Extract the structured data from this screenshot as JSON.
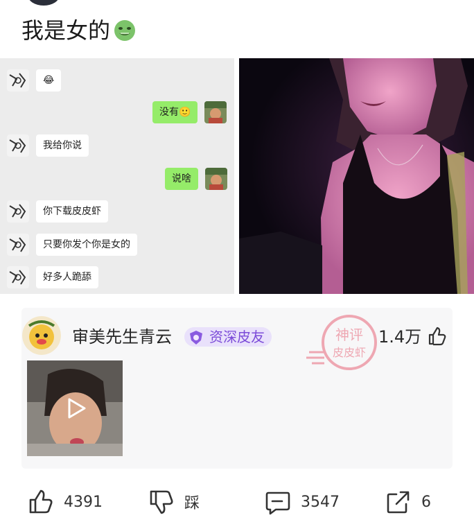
{
  "post": {
    "title": "我是女的"
  },
  "chat": {
    "messages": [
      {
        "side": "left",
        "text": "😂"
      },
      {
        "side": "right",
        "text": "没有🙂"
      },
      {
        "side": "left",
        "text": "我给你说"
      },
      {
        "side": "right",
        "text": "说啥"
      },
      {
        "side": "left",
        "text": "你下载皮皮虾"
      },
      {
        "side": "left",
        "text": "只要你发个你是女的"
      },
      {
        "side": "left",
        "text": "好多人跪舔"
      }
    ]
  },
  "comment": {
    "username": "审美先生青云",
    "badge": "资深皮友",
    "like_count": "1.4万",
    "stamp_text_1": "神评",
    "stamp_text_2": "皮皮虾"
  },
  "actions": {
    "like_count": "4391",
    "dislike_label": "踩",
    "comment_count": "3547",
    "share_count": "6"
  },
  "colors": {
    "wechat_green": "#95ec69",
    "badge_purple": "#7b4bd8",
    "stamp_red": "#e8667a"
  }
}
